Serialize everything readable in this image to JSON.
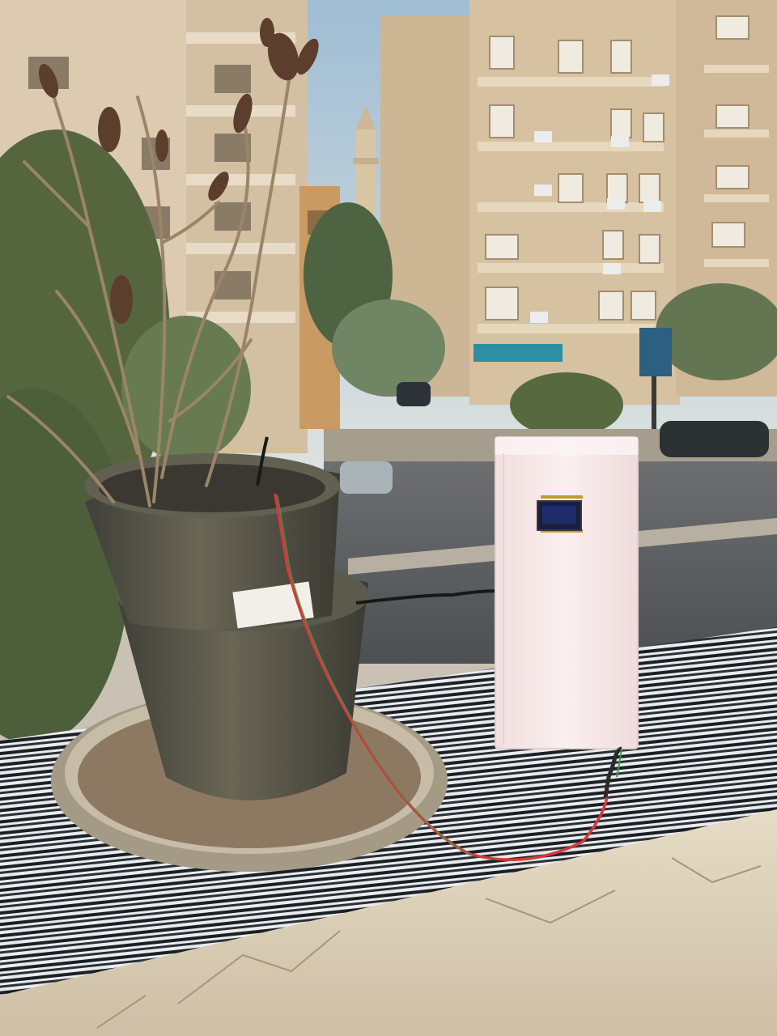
{
  "photo": {
    "subject": "",
    "colors": {
      "sky": "#b6cbd9",
      "building_left": "#d8c6aa",
      "building_right": "#d2bb9a",
      "tree": "#5d6e48",
      "road": "#5a5e5f",
      "ledge_tile_dark": "#1f2428",
      "ledge_tile_light": "#e5e7ea",
      "plaster": "#e3d8c2",
      "pot": "#5a5849",
      "saucer": "#b9ad98",
      "soil": "#8a7560",
      "enclosure": "#f6e9ea",
      "wire_red": "#d6383b",
      "wire_green": "#3c9f4e",
      "cable_black": "#1b1b1b"
    },
    "signs": {
      "shop_sign_text": "",
      "pole_sign_text": ""
    },
    "pot_label_text": ""
  }
}
